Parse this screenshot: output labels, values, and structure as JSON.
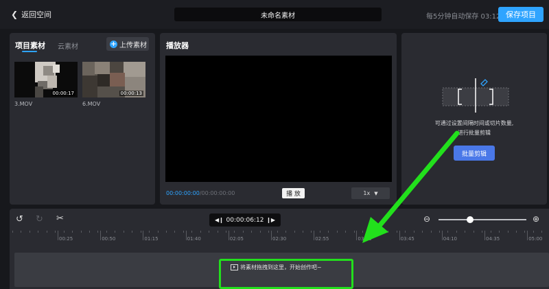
{
  "topbar": {
    "back_label": "返回空间",
    "project_title": "未命名素材",
    "autosave_text": "每5分钟自动保存 03:12",
    "save_label": "保存项目"
  },
  "materials": {
    "tab_project": "项目素材",
    "tab_cloud": "云素材",
    "upload_label": "上传素材",
    "items": [
      {
        "name": "3.MOV",
        "duration": "00:00:17"
      },
      {
        "name": "6.MOV",
        "duration": "00:00:13"
      }
    ]
  },
  "player": {
    "label": "播放器",
    "current_time": "00:00:00:00",
    "total_time": "/00:00:00:00",
    "play_label": "播 放",
    "speed": "1x"
  },
  "batch": {
    "description_line1": "可通过设置间隔时间或切片数量,",
    "description_line2": "进行批量剪辑",
    "button_label": "批量剪辑"
  },
  "timeline": {
    "timecode": "00:00:06:12",
    "ruler_labels": [
      "00:25",
      "00:50",
      "01:15",
      "01:40",
      "02:05",
      "02:30",
      "02:55",
      "03:20",
      "03:45",
      "04:10",
      "04:35",
      "05:00"
    ],
    "drop_hint": "将素材拖拽到这里，开始创作吧~"
  },
  "colors": {
    "accent": "#2fa4ff",
    "highlight": "#22e01c",
    "batch_button": "#4a78e8"
  }
}
